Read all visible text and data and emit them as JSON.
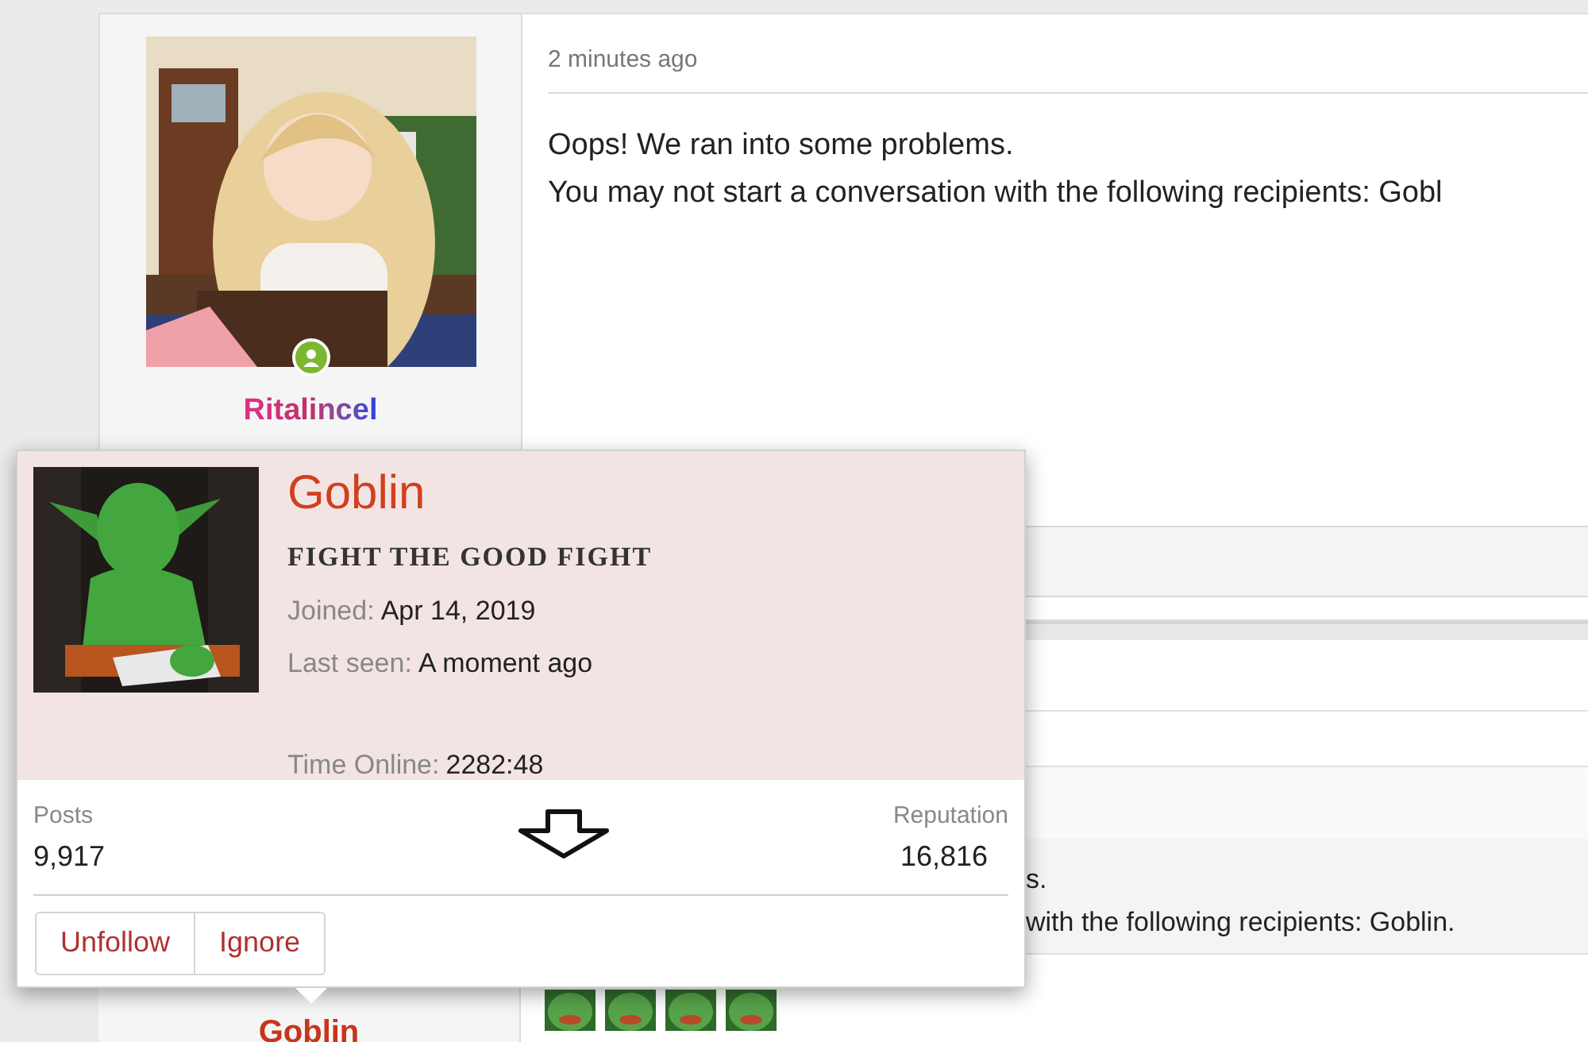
{
  "post": {
    "time": "2 minutes ago",
    "author": "Ritalincel",
    "online": true,
    "message_lines": [
      "Oops! We ran into some problems.",
      "You may not start a conversation with the following recipients: Gobl"
    ]
  },
  "post2": {
    "author": "Goblin",
    "message_lines": [
      "s.",
      "with the following recipients: Goblin."
    ]
  },
  "popup": {
    "name": "Goblin",
    "user_title": "FIGHT THE GOOD FIGHT",
    "fields": [
      {
        "label": "Joined:",
        "value": "Apr 14, 2019"
      },
      {
        "label": "Last seen:",
        "value": "A moment ago"
      }
    ],
    "time_online": {
      "label": "Time Online:",
      "value": "2282:48"
    },
    "stats": [
      {
        "label": "Posts",
        "value": "9,917"
      },
      {
        "label": "Reputation",
        "value": "16,816"
      }
    ],
    "buttons": [
      "Unfollow",
      "Ignore"
    ]
  }
}
